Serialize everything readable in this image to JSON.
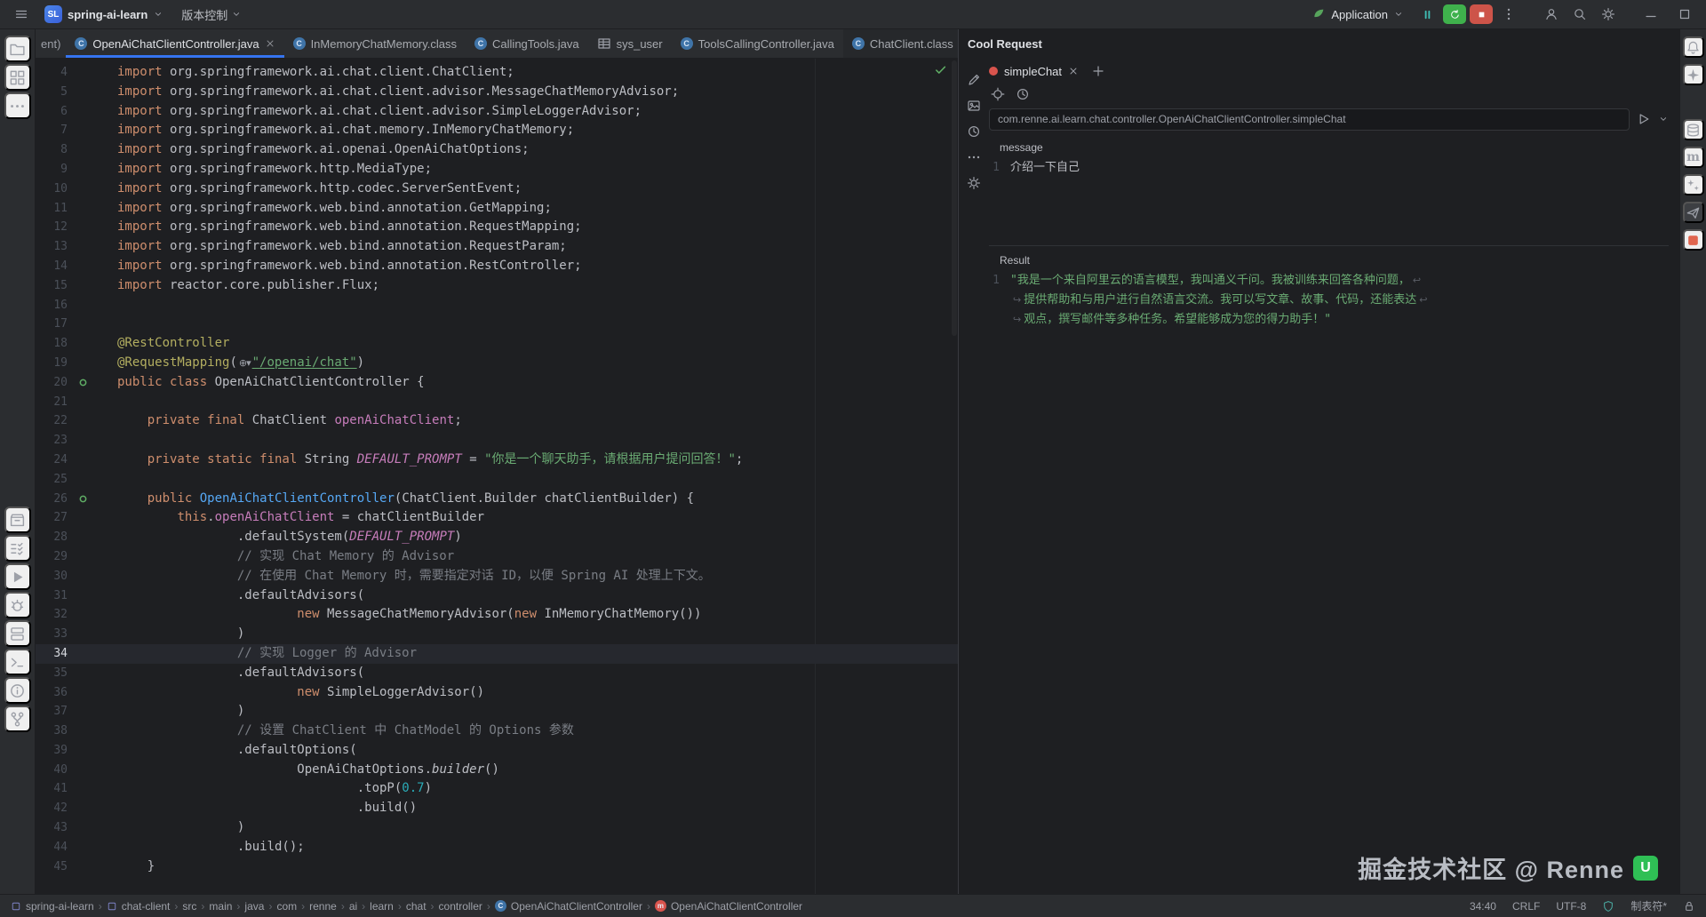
{
  "colors": {
    "accent": "#3574f0",
    "keyword": "#cf8e6d",
    "string": "#6aab73",
    "comment": "#7a7e85",
    "annotation": "#b3ae60",
    "field": "#c77dbb",
    "number": "#2aacb8",
    "run_green": "#3fb14c",
    "stop_red": "#cd5449"
  },
  "topbar": {
    "project_initials": "SL",
    "project_name": "spring-ai-learn",
    "vcs_label": "版本控制",
    "run_config_label": "Application"
  },
  "left_strip": {
    "top": [
      {
        "name": "project",
        "icon": "folder"
      },
      {
        "name": "structure",
        "icon": "structure"
      },
      {
        "name": "more-tools",
        "icon": "moreh"
      }
    ],
    "bottom": [
      {
        "name": "bookmarks",
        "icon": "archive"
      },
      {
        "name": "todo",
        "icon": "todo"
      },
      {
        "name": "run",
        "icon": "run"
      },
      {
        "name": "debug",
        "icon": "debug"
      },
      {
        "name": "services",
        "icon": "services"
      },
      {
        "name": "terminal",
        "icon": "terminal"
      },
      {
        "name": "problems",
        "icon": "problems"
      },
      {
        "name": "version-control",
        "icon": "branch"
      }
    ]
  },
  "right_strip": {
    "items": [
      {
        "name": "notifications",
        "icon": "bell"
      },
      {
        "name": "ai-assistant",
        "icon": "star4"
      },
      {
        "gap": true
      },
      {
        "name": "database",
        "icon": "db"
      },
      {
        "name": "maven",
        "text": "m"
      },
      {
        "name": "plugins",
        "icon": "sparkles"
      },
      {
        "name": "cool-request",
        "icon": "plane",
        "selected": true
      },
      {
        "name": "coverage",
        "icon": "redsq",
        "red": true
      }
    ]
  },
  "tab_bar": {
    "tabs": [
      {
        "label": "ent)",
        "partial": true
      },
      {
        "label": "OpenAiChatClientController.java",
        "icon": "class",
        "active": true,
        "closable": true
      },
      {
        "label": "InMemoryChatMemory.class",
        "icon": "class"
      },
      {
        "label": "CallingTools.java",
        "icon": "class"
      },
      {
        "label": "sys_user",
        "icon": "table"
      },
      {
        "label": "ToolsCallingController.java",
        "icon": "class"
      },
      {
        "label": "ChatClient.class",
        "icon": "class",
        "dim": true,
        "badge_dot": true
      }
    ]
  },
  "editor": {
    "current_line": 34,
    "lines": [
      {
        "n": 4,
        "segs": [
          [
            "k",
            "import"
          ],
          [
            "p",
            " org.springframework.ai.chat.client.ChatClient;"
          ]
        ]
      },
      {
        "n": 5,
        "segs": [
          [
            "k",
            "import"
          ],
          [
            "p",
            " org.springframework.ai.chat.client.advisor.MessageChatMemoryAdvisor;"
          ]
        ]
      },
      {
        "n": 6,
        "segs": [
          [
            "k",
            "import"
          ],
          [
            "p",
            " org.springframework.ai.chat.client.advisor.SimpleLoggerAdvisor;"
          ]
        ]
      },
      {
        "n": 7,
        "segs": [
          [
            "k",
            "import"
          ],
          [
            "p",
            " org.springframework.ai.chat.memory.InMemoryChatMemory;"
          ]
        ]
      },
      {
        "n": 8,
        "segs": [
          [
            "k",
            "import"
          ],
          [
            "p",
            " org.springframework.ai.openai.OpenAiChatOptions;"
          ]
        ]
      },
      {
        "n": 9,
        "segs": [
          [
            "k",
            "import"
          ],
          [
            "p",
            " org.springframework.http.MediaType;"
          ]
        ]
      },
      {
        "n": 10,
        "segs": [
          [
            "k",
            "import"
          ],
          [
            "p",
            " org.springframework.http.codec.ServerSentEvent;"
          ]
        ]
      },
      {
        "n": 11,
        "segs": [
          [
            "k",
            "import"
          ],
          [
            "p",
            " org.springframework.web.bind.annotation.GetMapping;"
          ]
        ]
      },
      {
        "n": 12,
        "segs": [
          [
            "k",
            "import"
          ],
          [
            "p",
            " org.springframework.web.bind.annotation.RequestMapping;"
          ]
        ]
      },
      {
        "n": 13,
        "segs": [
          [
            "k",
            "import"
          ],
          [
            "p",
            " org.springframework.web.bind.annotation.RequestParam;"
          ]
        ]
      },
      {
        "n": 14,
        "segs": [
          [
            "k",
            "import"
          ],
          [
            "p",
            " org.springframework.web.bind.annotation.RestController;"
          ]
        ]
      },
      {
        "n": 15,
        "segs": [
          [
            "k",
            "import"
          ],
          [
            "p",
            " reactor.core.publisher.Flux;"
          ]
        ]
      },
      {
        "n": 16,
        "segs": []
      },
      {
        "n": 17,
        "segs": []
      },
      {
        "n": 18,
        "segs": [
          [
            "a",
            "@RestController"
          ]
        ]
      },
      {
        "n": 19,
        "segs": [
          [
            "a",
            "@RequestMapping"
          ],
          [
            "p",
            "("
          ],
          [
            "g",
            "⊕▾"
          ],
          [
            "u",
            "\"/openai/chat\""
          ],
          [
            "p",
            ")"
          ]
        ]
      },
      {
        "n": 20,
        "segs": [
          [
            "k",
            "public class "
          ],
          [
            "p",
            "OpenAiChatClientController {"
          ]
        ],
        "gicon": "endpoint"
      },
      {
        "n": 21,
        "segs": []
      },
      {
        "n": 22,
        "segs": [
          [
            "p",
            "    "
          ],
          [
            "k",
            "private final "
          ],
          [
            "p",
            "ChatClient "
          ],
          [
            "f",
            "openAiChatClient"
          ],
          [
            "p",
            ";"
          ]
        ]
      },
      {
        "n": 23,
        "segs": []
      },
      {
        "n": 24,
        "segs": [
          [
            "p",
            "    "
          ],
          [
            "k",
            "private static final "
          ],
          [
            "p",
            "String "
          ],
          [
            "fi",
            "DEFAULT_PROMPT"
          ],
          [
            "p",
            " = "
          ],
          [
            "s",
            "\"你是一个聊天助手，请根据用户提问回答！\""
          ],
          [
            "p",
            ";"
          ]
        ]
      },
      {
        "n": 25,
        "segs": []
      },
      {
        "n": 26,
        "segs": [
          [
            "p",
            "    "
          ],
          [
            "k",
            "public "
          ],
          [
            "m",
            "OpenAiChatClientController"
          ],
          [
            "p",
            "(ChatClient.Builder chatClientBuilder) {"
          ]
        ],
        "gicon": "endpoint"
      },
      {
        "n": 27,
        "segs": [
          [
            "p",
            "        "
          ],
          [
            "k",
            "this"
          ],
          [
            "p",
            "."
          ],
          [
            "f",
            "openAiChatClient"
          ],
          [
            "p",
            " = chatClientBuilder"
          ]
        ]
      },
      {
        "n": 28,
        "segs": [
          [
            "p",
            "                .defaultSystem("
          ],
          [
            "fi",
            "DEFAULT_PROMPT"
          ],
          [
            "p",
            ")"
          ]
        ]
      },
      {
        "n": 29,
        "segs": [
          [
            "p",
            "                "
          ],
          [
            "c",
            "// 实现 Chat Memory 的 Advisor"
          ]
        ]
      },
      {
        "n": 30,
        "segs": [
          [
            "p",
            "                "
          ],
          [
            "c",
            "// 在使用 Chat Memory 时，需要指定对话 ID，以便 Spring AI 处理上下文。"
          ]
        ]
      },
      {
        "n": 31,
        "segs": [
          [
            "p",
            "                .defaultAdvisors("
          ]
        ]
      },
      {
        "n": 32,
        "segs": [
          [
            "p",
            "                        "
          ],
          [
            "k",
            "new "
          ],
          [
            "p",
            "MessageChatMemoryAdvisor("
          ],
          [
            "k",
            "new "
          ],
          [
            "p",
            "InMemoryChatMemory())"
          ]
        ]
      },
      {
        "n": 33,
        "segs": [
          [
            "p",
            "                )"
          ]
        ]
      },
      {
        "n": 34,
        "segs": [
          [
            "p",
            "                "
          ],
          [
            "c",
            "// 实现 Logger 的 Advisor"
          ]
        ]
      },
      {
        "n": 35,
        "segs": [
          [
            "p",
            "                .defaultAdvisors("
          ]
        ]
      },
      {
        "n": 36,
        "segs": [
          [
            "p",
            "                        "
          ],
          [
            "k",
            "new "
          ],
          [
            "p",
            "SimpleLoggerAdvisor()"
          ]
        ]
      },
      {
        "n": 37,
        "segs": [
          [
            "p",
            "                )"
          ]
        ]
      },
      {
        "n": 38,
        "segs": [
          [
            "p",
            "                "
          ],
          [
            "c",
            "// 设置 ChatClient 中 ChatModel 的 Options 参数"
          ]
        ]
      },
      {
        "n": 39,
        "segs": [
          [
            "p",
            "                .defaultOptions("
          ]
        ]
      },
      {
        "n": 40,
        "segs": [
          [
            "p",
            "                        OpenAiChatOptions."
          ],
          [
            "it",
            "builder"
          ],
          [
            "p",
            "()"
          ]
        ]
      },
      {
        "n": 41,
        "segs": [
          [
            "p",
            "                                .topP("
          ],
          [
            "num",
            "0.7"
          ],
          [
            "p",
            ")"
          ]
        ]
      },
      {
        "n": 42,
        "segs": [
          [
            "p",
            "                                .build()"
          ]
        ]
      },
      {
        "n": 43,
        "segs": [
          [
            "p",
            "                )"
          ]
        ]
      },
      {
        "n": 44,
        "segs": [
          [
            "p",
            "                .build();"
          ]
        ]
      },
      {
        "n": 45,
        "segs": [
          [
            "p",
            "    }"
          ]
        ]
      }
    ]
  },
  "cool_request": {
    "title": "Cool Request",
    "tab_label": "simpleChat",
    "url_value": "com.renne.ai.learn.chat.controller.OpenAiChatClientController.simpleChat",
    "message_label": "message",
    "message_line_no": "1",
    "message_text": "介绍一下自己",
    "result_label": "Result",
    "result_line_no": "1",
    "result_lines": [
      "\"我是一个来自阿里云的语言模型，我叫通义千问。我被训练来回答各种问题，",
      "提供帮助和与用户进行自然语言交流。我可以写文章、故事、代码，还能表达",
      "观点，撰写邮件等多种任务。希望能够成为您的得力助手！\""
    ]
  },
  "watermark": {
    "text": "掘金技术社区 @ Renne",
    "logo": "U"
  },
  "statusbar": {
    "breadcrumbs": [
      {
        "label": "spring-ai-learn",
        "icon": "module"
      },
      {
        "label": "chat-client",
        "icon": "module"
      },
      {
        "label": "src"
      },
      {
        "label": "main"
      },
      {
        "label": "java"
      },
      {
        "label": "com"
      },
      {
        "label": "renne"
      },
      {
        "label": "ai"
      },
      {
        "label": "learn"
      },
      {
        "label": "chat"
      },
      {
        "label": "controller"
      },
      {
        "label": "OpenAiChatClientController",
        "badge": "cls"
      },
      {
        "label": "OpenAiChatClientController",
        "badge": "mth"
      }
    ],
    "caret": "34:40",
    "line_sep": "CRLF",
    "encoding": "UTF-8",
    "indent": "制表符*"
  }
}
